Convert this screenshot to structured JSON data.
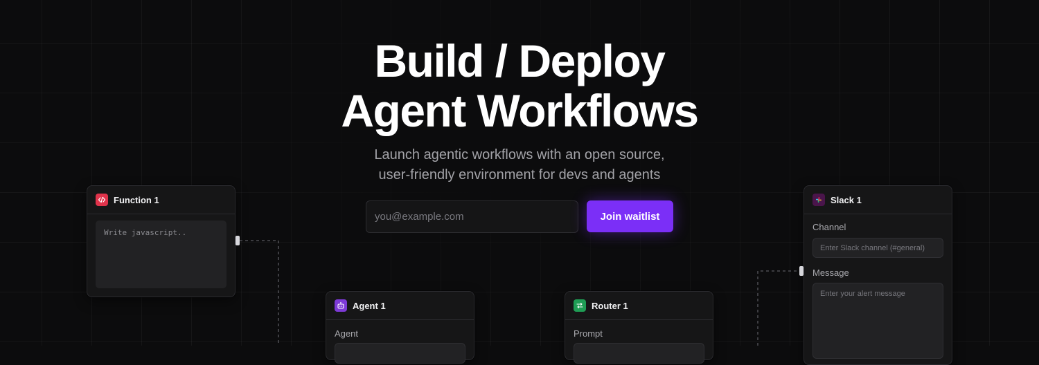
{
  "hero": {
    "headline_line1": "Build / Deploy",
    "headline_line2": "Agent Workflows",
    "subtitle_line1": "Launch agentic workflows with an open source,",
    "subtitle_line2": "user-friendly environment for devs and agents"
  },
  "waitlist": {
    "email_placeholder": "you@example.com",
    "join_label": "Join waitlist"
  },
  "cards": {
    "function": {
      "title": "Function 1",
      "icon": "code-icon",
      "icon_color": "#e0334b",
      "code_placeholder": "Write javascript.."
    },
    "agent": {
      "title": "Agent 1",
      "icon": "robot-icon",
      "icon_color": "#7d3ad6",
      "field_label": "Agent"
    },
    "router": {
      "title": "Router 1",
      "icon": "router-icon",
      "icon_color": "#1f9d55",
      "field_label": "Prompt"
    },
    "slack": {
      "title": "Slack 1",
      "icon": "slack-icon",
      "icon_color": "#4a154b",
      "channel_label": "Channel",
      "channel_placeholder": "Enter Slack channel (#general)",
      "message_label": "Message",
      "message_placeholder": "Enter your alert message"
    }
  },
  "colors": {
    "background": "#0c0c0d",
    "accent": "#7b2ff7",
    "card_background": "#161617"
  }
}
